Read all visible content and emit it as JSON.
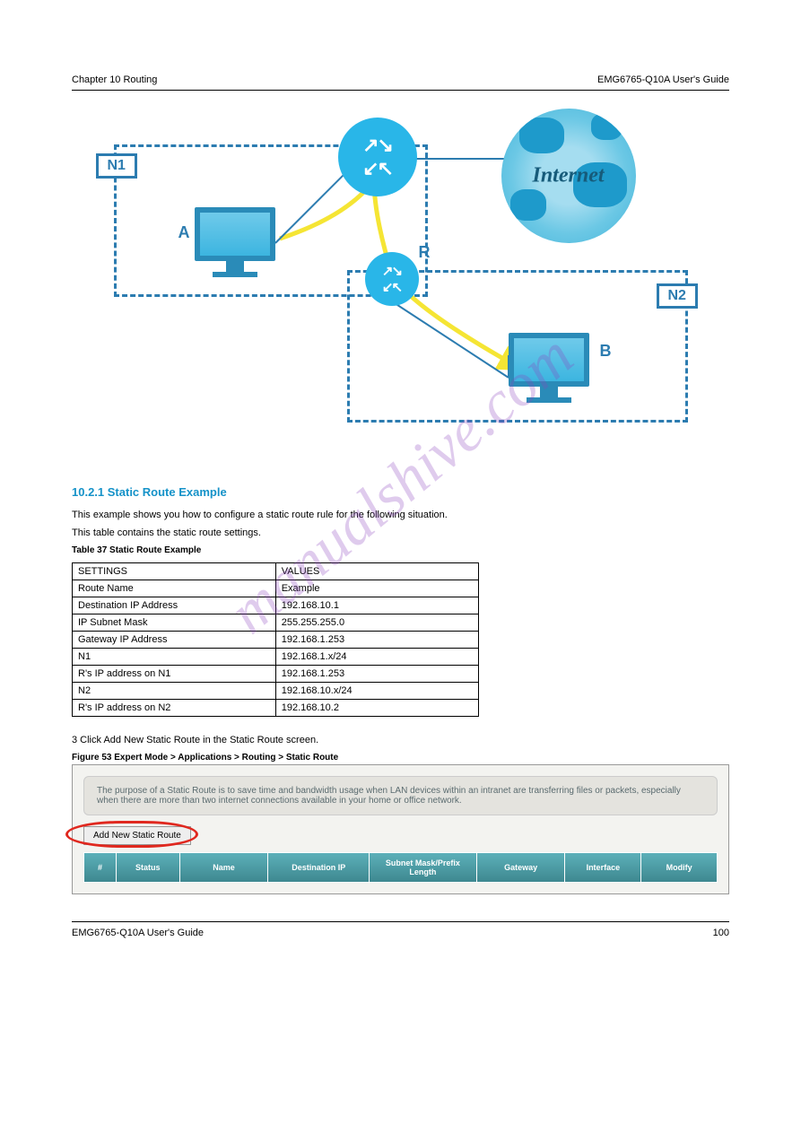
{
  "header": {
    "left": "Chapter 10 Routing",
    "right": "EMG6765-Q10A User's Guide"
  },
  "diagram": {
    "label_n1": "N1",
    "label_n2": "N2",
    "label_a": "A",
    "label_b": "B",
    "label_r": "R",
    "globe_text": "Internet"
  },
  "section": {
    "title": "10.2.1  Static Route Example",
    "para1": "This example shows you how to configure a static route rule for the following situation.",
    "para2": "This table contains the static route settings.",
    "para3": "3  Click Add New Static Route in the Static Route screen."
  },
  "table": {
    "caption_top": "Table 37  Static Route Example",
    "rows": [
      [
        "SETTINGS",
        "VALUES"
      ],
      [
        "Route Name",
        "Example"
      ],
      [
        "Destination IP Address",
        "192.168.10.1"
      ],
      [
        "IP Subnet Mask",
        "255.255.255.0"
      ],
      [
        "Gateway IP Address",
        "192.168.1.253"
      ],
      [
        "N1",
        "192.168.1.x/24"
      ],
      [
        "R's IP address on N1",
        "192.168.1.253"
      ],
      [
        "N2",
        "192.168.10.x/24"
      ],
      [
        "R's IP address on N2",
        "192.168.10.2"
      ]
    ]
  },
  "ui": {
    "notice": "The purpose of a Static Route is to save time and bandwidth usage when LAN devices within an intranet are transferring files or packets, especially when there are more than two internet connections available in your home or office network.",
    "button": "Add New Static Route",
    "headers": [
      "#",
      "Status",
      "Name",
      "Destination IP",
      "Subnet Mask/Prefix Length",
      "Gateway",
      "Interface",
      "Modify"
    ]
  },
  "figure": {
    "caption": "Figure 53  Expert Mode > Applications > Routing > Static Route"
  },
  "footer": {
    "left": "EMG6765-Q10A User's Guide",
    "right": "100"
  },
  "watermark": "manualshive.com"
}
